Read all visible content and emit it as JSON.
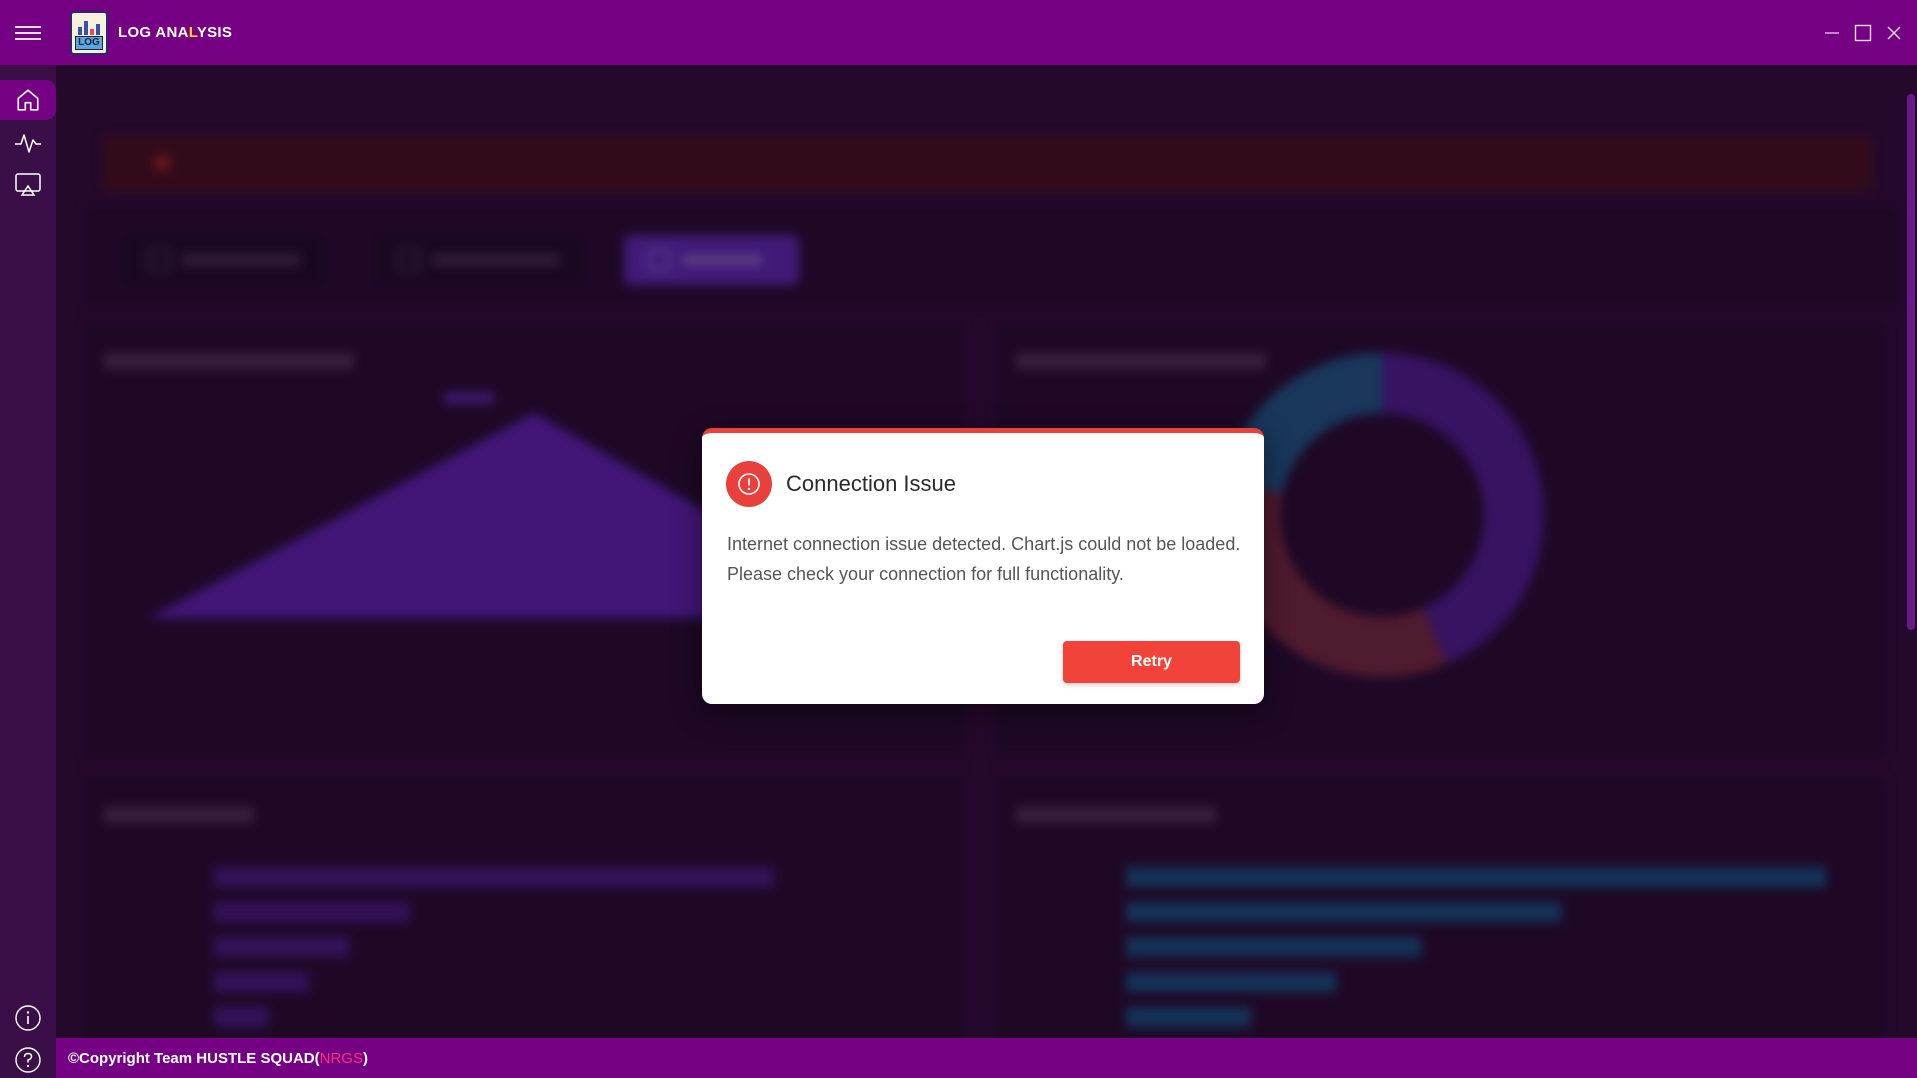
{
  "app": {
    "title_part1": "LOG ANA",
    "title_accent": "L",
    "title_part2": "YSIS",
    "logo_text": "LOG"
  },
  "sidebar": {
    "items": [
      {
        "name": "home",
        "icon": "home-icon"
      },
      {
        "name": "activity",
        "icon": "activity-icon"
      },
      {
        "name": "cast",
        "icon": "cast-icon"
      }
    ],
    "bottom": [
      {
        "name": "info",
        "icon": "info-icon"
      },
      {
        "name": "help",
        "icon": "help-icon"
      }
    ]
  },
  "dialog": {
    "title": "Connection Issue",
    "message": "Internet connection issue detected. Chart.js could not be loaded. Please check your connection for full functionality.",
    "retry_label": "Retry",
    "icon": "alert-circle-icon"
  },
  "footer": {
    "copyright": "©Copyright Team HUSTLE SQUAD(",
    "nrgs": "NRGS",
    "close_paren": ")"
  },
  "colors": {
    "accent": "#760083",
    "danger": "#e8403a",
    "sidebar_bg": "#3a0f48",
    "main_bg": "#2a0b33"
  }
}
